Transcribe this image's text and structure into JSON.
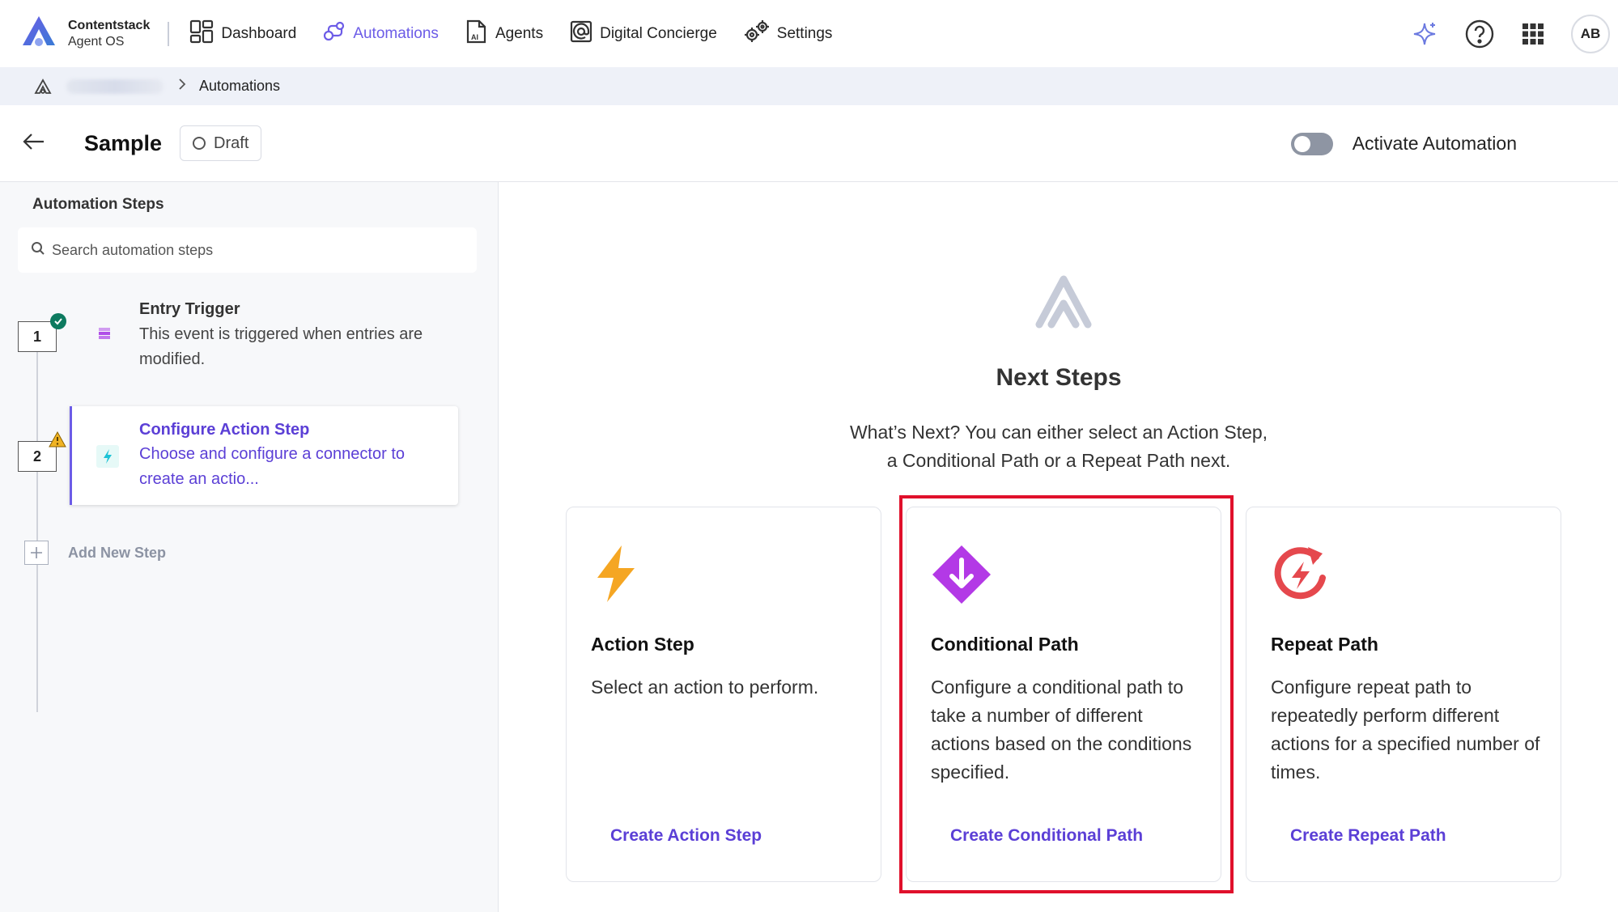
{
  "brand": {
    "name": "Contentstack",
    "sub": "Agent OS"
  },
  "nav": {
    "items": [
      {
        "label": "Dashboard",
        "icon": "dashboard-icon"
      },
      {
        "label": "Automations",
        "icon": "automations-icon",
        "active": true
      },
      {
        "label": "Agents",
        "icon": "agents-icon"
      },
      {
        "label": "Digital Concierge",
        "icon": "concierge-icon"
      },
      {
        "label": "Settings",
        "icon": "settings-icon"
      }
    ],
    "avatar_initials": "AB"
  },
  "breadcrumb": {
    "current": "Automations"
  },
  "header": {
    "title": "Sample",
    "status": "Draft",
    "activate_label": "Activate Automation",
    "activate_on": false
  },
  "sidebar": {
    "title": "Automation Steps",
    "search_placeholder": "Search automation steps",
    "steps": [
      {
        "number": "1",
        "title": "Entry Trigger",
        "desc": "This event is triggered when entries are modified.",
        "status": "complete"
      },
      {
        "number": "2",
        "title": "Configure Action Step",
        "desc": "Choose and configure a connector to create an actio...",
        "status": "warning"
      }
    ],
    "add_step_label": "Add New Step"
  },
  "main": {
    "heading": "Next Steps",
    "description_line1": "What’s Next? You can either select an Action Step,",
    "description_line2": "a Conditional Path or a Repeat Path next.",
    "cards": [
      {
        "title": "Action Step",
        "desc": "Select an action to perform.",
        "link": "Create Action Step",
        "icon": "lightning-icon"
      },
      {
        "title": "Conditional Path",
        "desc": "Configure a conditional path to take a number of different actions based on the conditions specified.",
        "link": "Create Conditional Path",
        "icon": "conditional-icon"
      },
      {
        "title": "Repeat Path",
        "desc": "Configure repeat path to repeatedly perform different actions for a specified number of times.",
        "link": "Create Repeat Path",
        "icon": "repeat-icon"
      }
    ]
  },
  "colors": {
    "accent": "#6c5ce7",
    "link": "#5b3fd6",
    "highlight": "#e0102b",
    "lightning": "#f5a623",
    "conditional": "#b339e6",
    "repeat": "#e5484d",
    "success": "#0d7a5f",
    "warning": "#f0b323"
  }
}
